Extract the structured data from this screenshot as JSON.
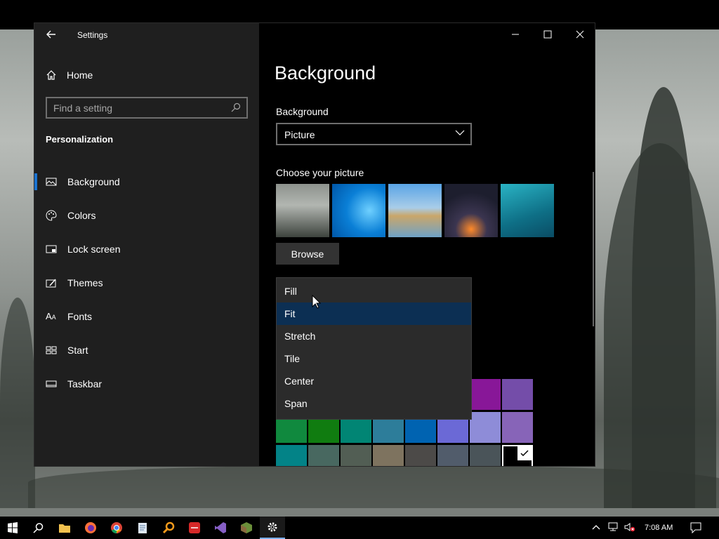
{
  "window": {
    "title": "Settings"
  },
  "sidebar": {
    "home_label": "Home",
    "search_placeholder": "Find a setting",
    "section_title": "Personalization",
    "items": [
      {
        "label": "Background",
        "icon": "picture-icon",
        "selected": true
      },
      {
        "label": "Colors",
        "icon": "palette-icon",
        "selected": false
      },
      {
        "label": "Lock screen",
        "icon": "lock-screen-icon",
        "selected": false
      },
      {
        "label": "Themes",
        "icon": "themes-icon",
        "selected": false
      },
      {
        "label": "Fonts",
        "icon": "fonts-icon",
        "selected": false
      },
      {
        "label": "Start",
        "icon": "start-icon",
        "selected": false
      },
      {
        "label": "Taskbar",
        "icon": "taskbar-icon",
        "selected": false
      }
    ]
  },
  "main": {
    "page_title": "Background",
    "background_label": "Background",
    "background_value": "Picture",
    "choose_picture_label": "Choose your picture",
    "browse_label": "Browse",
    "fit_options": [
      {
        "label": "Fill",
        "highlighted": false
      },
      {
        "label": "Fit",
        "highlighted": true
      },
      {
        "label": "Stretch",
        "highlighted": false
      },
      {
        "label": "Tile",
        "highlighted": false
      },
      {
        "label": "Center",
        "highlighted": false
      },
      {
        "label": "Span",
        "highlighted": false
      }
    ],
    "color_swatches_partial_row": [
      "#881798",
      "#744da9"
    ],
    "color_swatches_row2": [
      "#10893e",
      "#107c10",
      "#018574",
      "#2d7d9a",
      "#0063b1",
      "#6b69d6",
      "#8e8cd8",
      "#8764b8"
    ],
    "color_swatches_row3": [
      "#038387",
      "#486860",
      "#525e54",
      "#7e735f",
      "#4c4a48",
      "#515c6b",
      "#4a5459",
      "#000000"
    ],
    "selected_swatch": "#000000"
  },
  "taskbar": {
    "clock": "7:08 AM",
    "apps": [
      "windows-start-icon",
      "search-icon",
      "file-explorer-icon",
      "firefox-icon",
      "chrome-icon",
      "notepad-icon",
      "search-tool-icon",
      "dev-tool-icon",
      "visual-studio-icon",
      "minecraft-icon",
      "settings-gear-icon"
    ]
  },
  "colors": {
    "accent": "#1a73d1",
    "highlight": "#0c2f53"
  }
}
